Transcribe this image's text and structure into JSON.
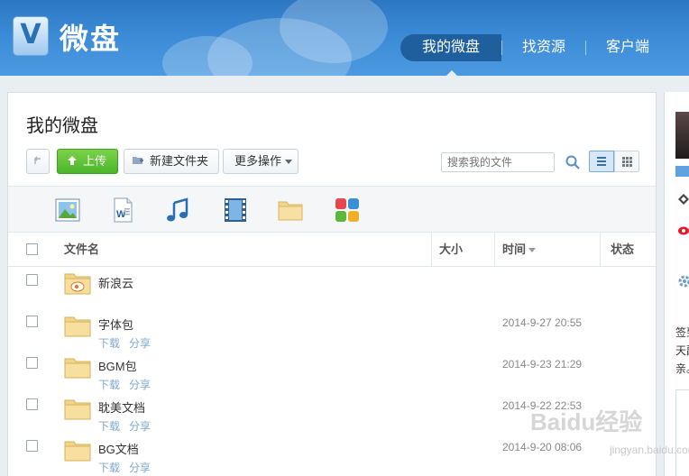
{
  "brand": {
    "logo_letter": "V",
    "name": "微盘"
  },
  "nav": {
    "items": [
      "我的微盘",
      "找资源",
      "客户端"
    ]
  },
  "page": {
    "title": "我的微盘"
  },
  "toolbar": {
    "upload_label": "上传",
    "new_folder_label": "新建文件夹",
    "more_label": "更多操作",
    "search_placeholder": "搜索我的文件"
  },
  "file_types": [
    "image",
    "document",
    "music",
    "video",
    "folder",
    "apps"
  ],
  "table": {
    "headers": {
      "name": "文件名",
      "size": "大小",
      "time": "时间",
      "status": "状态"
    }
  },
  "files": [
    {
      "name": "新浪云",
      "date": "",
      "download": "",
      "share": "",
      "icon": "weibo-folder-icon"
    },
    {
      "name": "字体包",
      "date": "2014-9-27 20:55",
      "download": "下载",
      "share": "分享",
      "icon": "folder-icon"
    },
    {
      "name": "BGM包",
      "date": "2014-9-23 21:29",
      "download": "下载",
      "share": "分享",
      "icon": "folder-icon"
    },
    {
      "name": "耽美文档",
      "date": "2014-9-22 22:53",
      "download": "下载",
      "share": "分享",
      "icon": "folder-icon"
    },
    {
      "name": "BG文档",
      "date": "2014-9-20 08:06",
      "download": "下载",
      "share": "分享",
      "icon": "folder-icon"
    }
  ],
  "sidebar": {
    "text_1": "签到",
    "text_2": "天副",
    "text_3": "亲。"
  },
  "watermark": {
    "text": "Baidu经验",
    "sub": "jingyan.baidu.com"
  },
  "colors": {
    "header": "#3b8ad6",
    "upload": "#4bb52a",
    "link": "#7fa8cf"
  }
}
